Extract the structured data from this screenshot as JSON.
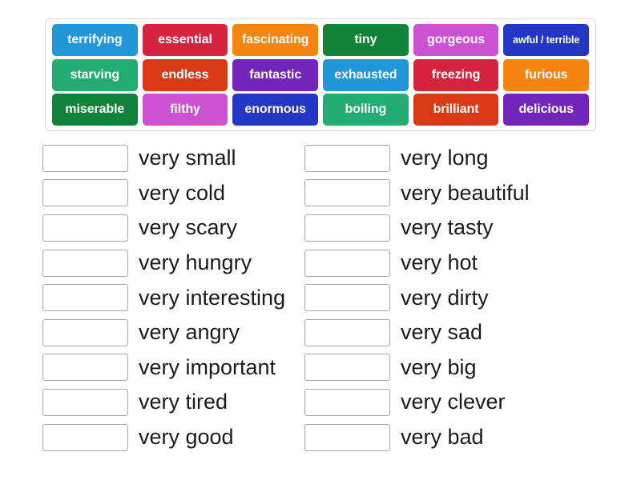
{
  "word_bank": {
    "rows": [
      [
        {
          "label": "terrifying",
          "color": "#2196d9",
          "small": false
        },
        {
          "label": "essential",
          "color": "#d62440",
          "small": false
        },
        {
          "label": "fascinating",
          "color": "#f58410",
          "small": false
        },
        {
          "label": "tiny",
          "color": "#118239",
          "small": false
        },
        {
          "label": "gorgeous",
          "color": "#cc51d3",
          "small": false
        },
        {
          "label": "awful / terrible",
          "color": "#2337c4",
          "small": true
        }
      ],
      [
        {
          "label": "starving",
          "color": "#23ad72",
          "small": false
        },
        {
          "label": "endless",
          "color": "#d93a15",
          "small": false
        },
        {
          "label": "fantastic",
          "color": "#7224bb",
          "small": false
        },
        {
          "label": "exhausted",
          "color": "#2196d9",
          "small": false
        },
        {
          "label": "freezing",
          "color": "#d62440",
          "small": false
        },
        {
          "label": "furious",
          "color": "#f58410",
          "small": false
        }
      ],
      [
        {
          "label": "miserable",
          "color": "#118239",
          "small": false
        },
        {
          "label": "filthy",
          "color": "#cc51d3",
          "small": false
        },
        {
          "label": "enormous",
          "color": "#2337c4",
          "small": false
        },
        {
          "label": "boiling",
          "color": "#23ad72",
          "small": false
        },
        {
          "label": "brilliant",
          "color": "#d93a15",
          "small": false
        },
        {
          "label": "delicious",
          "color": "#7224bb",
          "small": false
        }
      ]
    ]
  },
  "answers": {
    "left": [
      {
        "definition": "very small",
        "value": ""
      },
      {
        "definition": "very cold",
        "value": ""
      },
      {
        "definition": "very scary",
        "value": ""
      },
      {
        "definition": "very hungry",
        "value": ""
      },
      {
        "definition": "very interesting",
        "value": ""
      },
      {
        "definition": "very angry",
        "value": ""
      },
      {
        "definition": "very important",
        "value": ""
      },
      {
        "definition": "very tired",
        "value": ""
      },
      {
        "definition": "very good",
        "value": ""
      }
    ],
    "right": [
      {
        "definition": "very long",
        "value": ""
      },
      {
        "definition": "very beautiful",
        "value": ""
      },
      {
        "definition": "very tasty",
        "value": ""
      },
      {
        "definition": "very hot",
        "value": ""
      },
      {
        "definition": "very dirty",
        "value": ""
      },
      {
        "definition": "very sad",
        "value": ""
      },
      {
        "definition": "very big",
        "value": ""
      },
      {
        "definition": "very clever",
        "value": ""
      },
      {
        "definition": "very bad",
        "value": ""
      }
    ]
  }
}
